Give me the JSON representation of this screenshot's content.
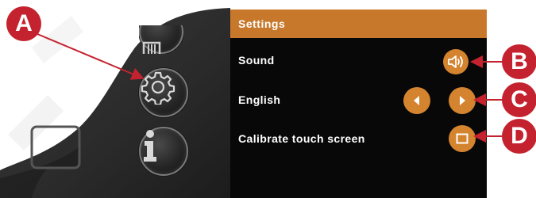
{
  "callouts": {
    "a": "A",
    "b": "B",
    "c": "C",
    "d": "D",
    "color": "#c4222f"
  },
  "device": {
    "buttons": [
      {
        "name": "trash-button",
        "icon": "trash-icon"
      },
      {
        "name": "settings-button",
        "icon": "gear-icon"
      },
      {
        "name": "info-button",
        "icon": "info-icon"
      }
    ]
  },
  "settings": {
    "title": "Settings",
    "header_color": "#c8782b",
    "button_color": "#d4832f",
    "rows": {
      "sound": {
        "label": "Sound",
        "icon": "speaker-icon"
      },
      "language": {
        "label": "English",
        "prev_icon": "triangle-left-icon",
        "next_icon": "triangle-right-icon"
      },
      "calibrate": {
        "label": "Calibrate touch screen",
        "icon": "square-icon"
      }
    }
  }
}
